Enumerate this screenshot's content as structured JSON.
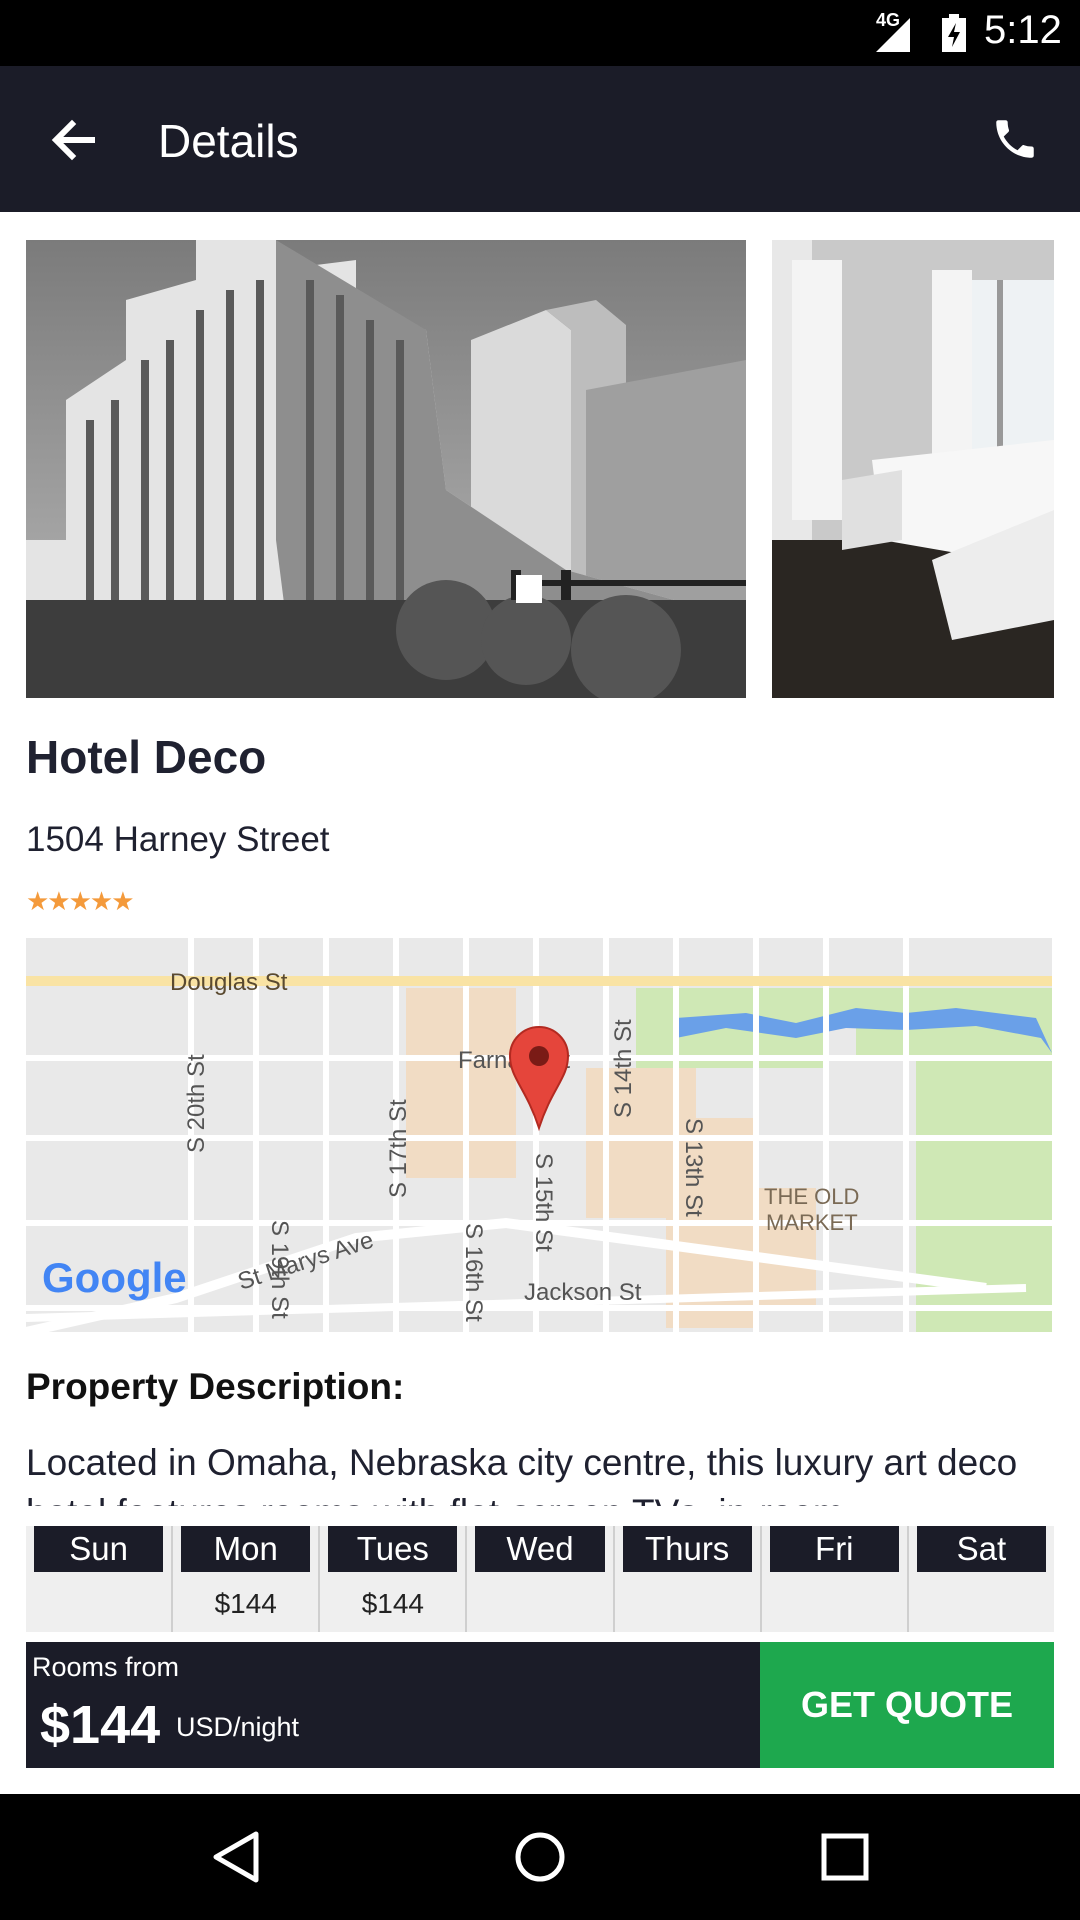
{
  "status_bar": {
    "network": "4G",
    "time": "5:12"
  },
  "app_bar": {
    "title": "Details",
    "back_icon": "arrow-left-icon",
    "call_icon": "phone-icon"
  },
  "hotel": {
    "name": "Hotel Deco",
    "address": "1504 Harney Street",
    "stars_display": "★★★★★",
    "rating": 4.5
  },
  "map": {
    "logo": "Google",
    "labels": {
      "douglas": "Douglas St",
      "farnam": "Farnam St",
      "s14": "S 14th St",
      "s20": "S 20th St",
      "s19": "S 19th St",
      "s17": "S 17th St",
      "s16": "S 16th St",
      "s15": "S 15th St",
      "s13": "S 13th St",
      "marys": "St Marys Ave",
      "jackson": "Jackson St",
      "old_market_1": "THE OLD",
      "old_market_2": "MARKET"
    }
  },
  "description": {
    "heading": "Property Description:",
    "text": "Located in Omaha, Nebraska city centre, this luxury art deco hotel features rooms with flat-screen TVs, in-room"
  },
  "days": [
    {
      "name": "Sun",
      "price": ""
    },
    {
      "name": "Mon",
      "price": "$144"
    },
    {
      "name": "Tues",
      "price": "$144"
    },
    {
      "name": "Wed",
      "price": ""
    },
    {
      "name": "Thurs",
      "price": ""
    },
    {
      "name": "Fri",
      "price": ""
    },
    {
      "name": "Sat",
      "price": ""
    }
  ],
  "quote": {
    "rooms_from": "Rooms from",
    "price": "$144",
    "unit": "USD/night",
    "button": "GET QUOTE"
  },
  "colors": {
    "app_bar": "#1b1c28",
    "accent_green": "#1ea84e",
    "star": "#f49a3b"
  }
}
